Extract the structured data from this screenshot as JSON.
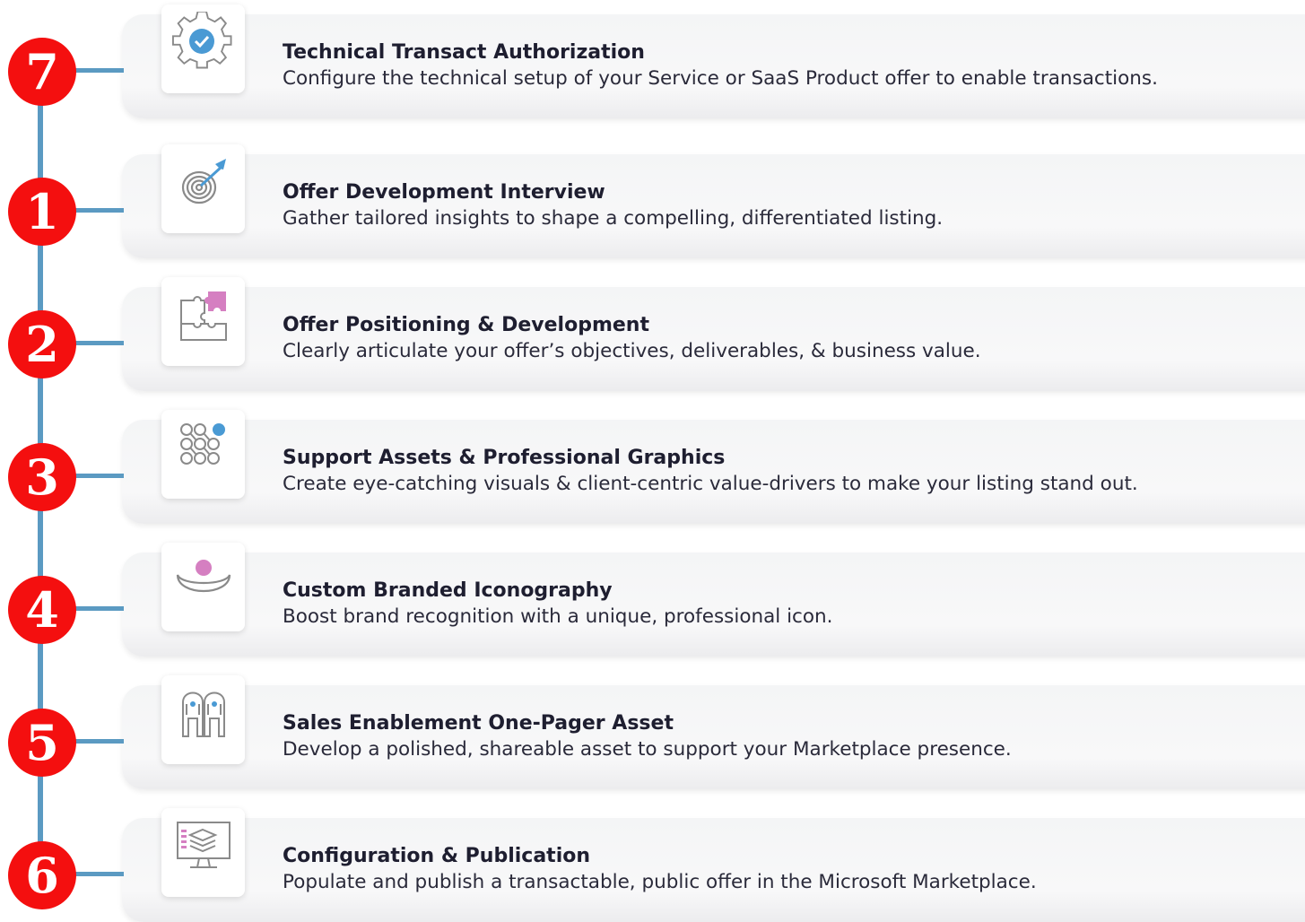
{
  "colors": {
    "badge": "#f40f0f",
    "connector": "#5b9ac2",
    "icon_gray": "#888888",
    "icon_blue": "#4a9ad4",
    "icon_pink": "#d57fc1"
  },
  "steps": [
    {
      "number": "1",
      "icon": "target-arrow-icon",
      "title": "Offer Development Interview",
      "description": "Gather tailored insights to shape a compelling, differentiated listing."
    },
    {
      "number": "2",
      "icon": "puzzle-pieces-icon",
      "title": "Offer Positioning & Development",
      "description": "Clearly articulate your offer’s objectives, deliverables, & business value."
    },
    {
      "number": "3",
      "icon": "connected-dots-icon",
      "title": "Support Assets & Professional Graphics",
      "description": "Create eye-catching visuals & client-centric value-drivers to make your listing stand out."
    },
    {
      "number": "4",
      "icon": "brand-emblem-icon",
      "title": "Custom Branded Iconography",
      "description": "Boost brand recognition with a unique, professional icon."
    },
    {
      "number": "5",
      "icon": "figures-icon",
      "title": "Sales Enablement One-Pager Asset",
      "description": "Develop a polished, shareable asset to support your Marketplace presence."
    },
    {
      "number": "6",
      "icon": "monitor-layers-icon",
      "title": "Configuration & Publication",
      "description": "Populate and publish a transactable, public offer in the Microsoft Marketplace."
    },
    {
      "number": "7",
      "icon": "gear-check-icon",
      "title": "Technical Transact Authorization",
      "description": "Configure the technical setup of your Service or SaaS Product offer to enable transactions."
    }
  ]
}
